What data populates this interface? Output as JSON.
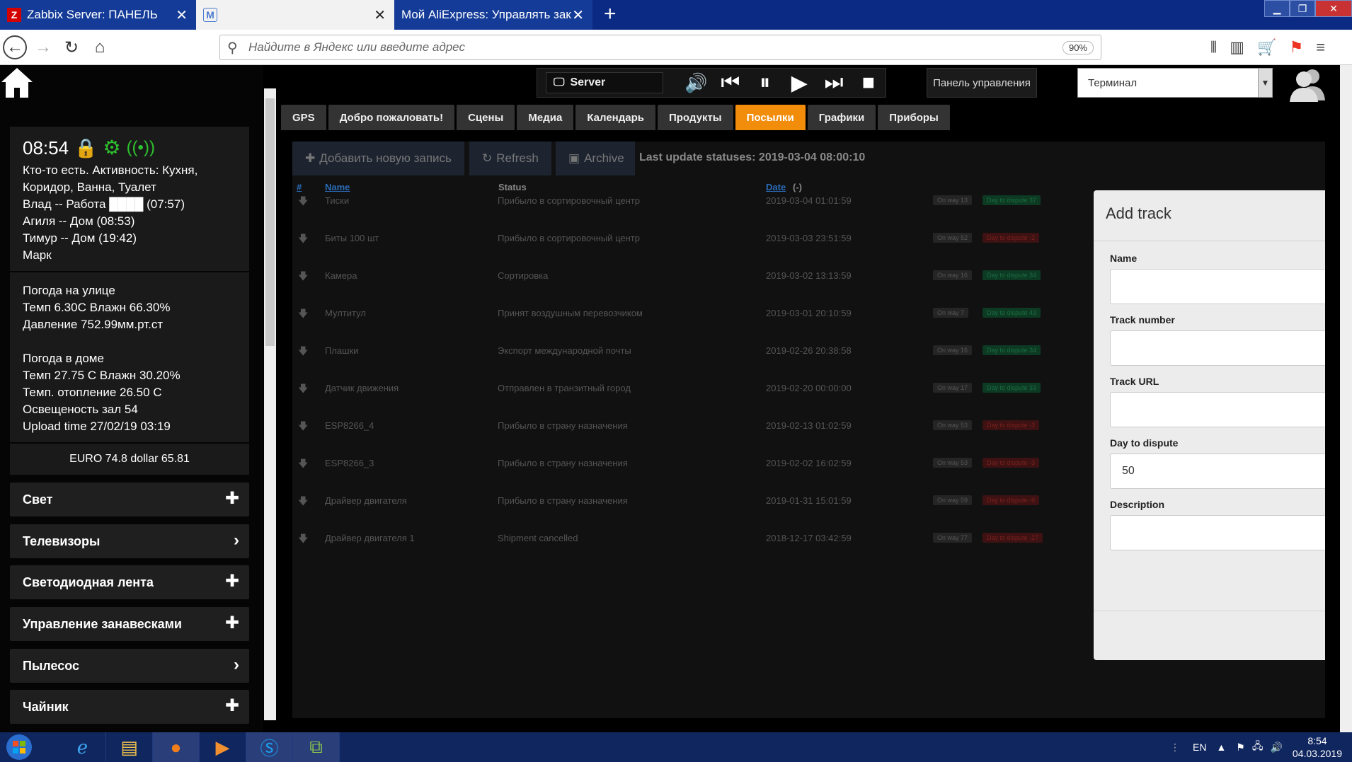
{
  "browser": {
    "tabs": [
      {
        "label": "Zabbix Server: ПАНЕЛЬ",
        "favicon": "Z"
      },
      {
        "label": "",
        "favicon": "M"
      },
      {
        "label": "Мой AliExpress: Управлять заказа",
        "favicon": ""
      }
    ],
    "new_tab": "+",
    "url_placeholder": "Найдите в Яндекс или введите адрес",
    "zoom": "90%"
  },
  "sidebar": {
    "time": "08:54",
    "presence": [
      "Кто-то есть. Активность: Кухня,",
      "Коридор, Ванна, Туалет",
      "Влад -- Работа ████ (07:57)",
      "Агиля -- Дом (08:53)",
      "Тимур -- Дом (19:42)",
      "Марк"
    ],
    "weather_out": [
      "Погода на улице",
      "Темп 6.30С Влажн 66.30%",
      "Давление 752.99мм.рт.ст"
    ],
    "weather_in": [
      "Погода в доме",
      "Темп 27.75 С Влажн 30.20%",
      "Темп. отопление 26.50 С",
      "Освещеность зал 54",
      "Upload time 27/02/19 03:19"
    ],
    "rates": "EURO 74.8   dollar 65.81",
    "menu": [
      {
        "label": "Свет",
        "icon": "plus"
      },
      {
        "label": "Телевизоры",
        "icon": "chevron"
      },
      {
        "label": "Светодиодная лента",
        "icon": "plus"
      },
      {
        "label": "Управление занавесками",
        "icon": "plus"
      },
      {
        "label": "Пылесос",
        "icon": "chevron"
      },
      {
        "label": "Чайник",
        "icon": "plus"
      }
    ]
  },
  "player": {
    "server": "Server"
  },
  "panel_button": "Панель управления",
  "terminal_select": "Терминал",
  "tabs": [
    "GPS",
    "Добро пожаловать!",
    "Сцены",
    "Медиа",
    "Календарь",
    "Продукты",
    "Посылки",
    "Графики",
    "Приборы"
  ],
  "active_tab": "Посылки",
  "toolbar": {
    "add": "Добавить новую запись",
    "refresh": "Refresh",
    "archive": "Archive",
    "last_update": "Last update statuses: 2019-03-04 08:00:10"
  },
  "table": {
    "headers": {
      "num": "#",
      "name": "Name",
      "status": "Status",
      "date": "Date",
      "date_sort": "(-)"
    },
    "rows": [
      {
        "name": "Тиски",
        "status": "Прибыло в сортировочный центр",
        "date": "2019-03-04 01:01:59",
        "way": "On way 13",
        "dispute": "Day to dispute 37",
        "ok": true
      },
      {
        "name": "Биты 100 шт",
        "status": "Прибыло в сортировочный центр",
        "date": "2019-03-03 23:51:59",
        "way": "On way 52",
        "dispute": "Day to dispute -2",
        "ok": false
      },
      {
        "name": "Камера",
        "status": "Сортировка",
        "date": "2019-03-02 13:13:59",
        "way": "On way 16",
        "dispute": "Day to dispute 34",
        "ok": true
      },
      {
        "name": "Мултитул",
        "status": "Принят воздушным перевозчиком",
        "date": "2019-03-01 20:10:59",
        "way": "On way 7",
        "dispute": "Day to dispute 43",
        "ok": true
      },
      {
        "name": "Плашки",
        "status": "Экспорт международной почты",
        "date": "2019-02-26 20:38:58",
        "way": "On way 16",
        "dispute": "Day to dispute 34",
        "ok": true
      },
      {
        "name": "Датчик движения",
        "status": "Отправлен в транзитный город",
        "date": "2019-02-20 00:00:00",
        "way": "On way 17",
        "dispute": "Day to dispute 33",
        "ok": true
      },
      {
        "name": "ESP8266_4",
        "status": "Прибыло в страну назначения",
        "date": "2019-02-13 01:02:59",
        "way": "On way 53",
        "dispute": "Day to dispute -3",
        "ok": false
      },
      {
        "name": "ESP8266_3",
        "status": "Прибыло в страну назначения",
        "date": "2019-02-02 16:02:59",
        "way": "On way 53",
        "dispute": "Day to dispute -3",
        "ok": false
      },
      {
        "name": "Драйвер двигателя",
        "status": "Прибыло в страну назначения",
        "date": "2019-01-31 15:01:59",
        "way": "On way 59",
        "dispute": "Day to dispute -9",
        "ok": false
      },
      {
        "name": "Драйвер двигателя 1",
        "status": "Shipment cancelled",
        "date": "2018-12-17 03:42:59",
        "way": "On way 77",
        "dispute": "Day to dispute -27",
        "ok": false
      }
    ]
  },
  "add_track": {
    "title": "Add track",
    "fields": [
      {
        "label": "Name",
        "value": ""
      },
      {
        "label": "Track number",
        "value": ""
      },
      {
        "label": "Track URL",
        "value": ""
      },
      {
        "label": "Day to dispute",
        "value": "50"
      },
      {
        "label": "Description",
        "value": ""
      }
    ]
  },
  "taskbar": {
    "lang": "EN",
    "time": "8:54",
    "date": "04.03.2019"
  }
}
